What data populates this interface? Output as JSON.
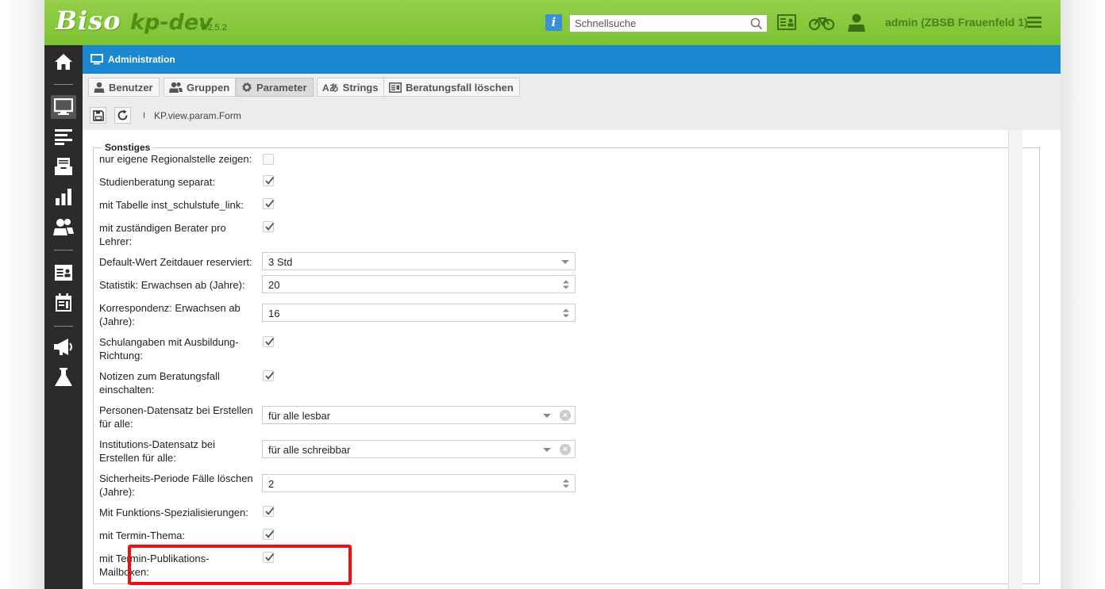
{
  "header": {
    "logo": "Biso",
    "app_name": "kp-dev",
    "version": "V.2.5.2",
    "search_placeholder": "Schnellsuche",
    "user": "admin (ZBSB Frauenfeld 1)",
    "accent_color": "#7cc230"
  },
  "sidebar": {
    "items": [
      {
        "icon": "home-icon"
      },
      {
        "icon": "monitor-icon",
        "active": true
      },
      {
        "icon": "list-icon"
      },
      {
        "icon": "inbox-icon"
      },
      {
        "icon": "bar-chart-icon"
      },
      {
        "icon": "users-icon"
      },
      {
        "icon": "contact-card-icon"
      },
      {
        "icon": "calendar-icon"
      },
      {
        "icon": "megaphone-icon"
      },
      {
        "icon": "flask-icon"
      }
    ]
  },
  "titlebar": {
    "title": "Administration",
    "color": "#1b87cf"
  },
  "tabs": [
    {
      "label": "Benutzer",
      "icon": "user-icon"
    },
    {
      "label": "Gruppen",
      "icon": "group-icon"
    },
    {
      "label": "Parameter",
      "icon": "gear-icon",
      "active": true
    },
    {
      "label": "Strings",
      "icon": "translate-icon"
    },
    {
      "label": "Beratungsfall löschen",
      "icon": "card-icon"
    }
  ],
  "breadcrumb": {
    "separator": "I",
    "path": "KP.view.param.Form"
  },
  "form": {
    "section": "Sonstiges",
    "rows": [
      {
        "label": "nur eigene Regionalstelle zeigen:",
        "type": "checkbox",
        "checked": false
      },
      {
        "label": "Studienberatung separat:",
        "type": "checkbox",
        "checked": true
      },
      {
        "label": "mit Tabelle inst_schulstufe_link:",
        "type": "checkbox",
        "checked": true
      },
      {
        "label": "mit zuständigen Berater pro Lehrer:",
        "type": "checkbox",
        "checked": true
      },
      {
        "label": "Default-Wert Zeitdauer reserviert:",
        "type": "select",
        "value": "3 Std"
      },
      {
        "label": "Statistik: Erwachsen ab (Jahre):",
        "type": "number",
        "value": "20"
      },
      {
        "label": "Korrespondenz: Erwachsen ab (Jahre):",
        "type": "number",
        "value": "16"
      },
      {
        "label": "Schulangaben mit Ausbildung-Richtung:",
        "type": "checkbox",
        "checked": true
      },
      {
        "label": "Notizen zum Beratungsfall einschalten:",
        "type": "checkbox",
        "checked": true
      },
      {
        "label": "Personen-Datensatz bei Erstellen für alle:",
        "type": "combo",
        "value": "für alle lesbar"
      },
      {
        "label": "Institutions-Datensatz bei Erstellen für alle:",
        "type": "combo",
        "value": "für alle schreibbar"
      },
      {
        "label": "Sicherheits-Periode Fälle löschen (Jahre):",
        "type": "number",
        "value": "2"
      },
      {
        "label": "Mit Funktions-Spezialisierungen:",
        "type": "checkbox",
        "checked": true
      },
      {
        "label": "mit Termin-Thema:",
        "type": "checkbox",
        "checked": true
      },
      {
        "label": "mit Termin-Publikations-Mailboxen:",
        "type": "checkbox",
        "checked": true
      }
    ]
  }
}
